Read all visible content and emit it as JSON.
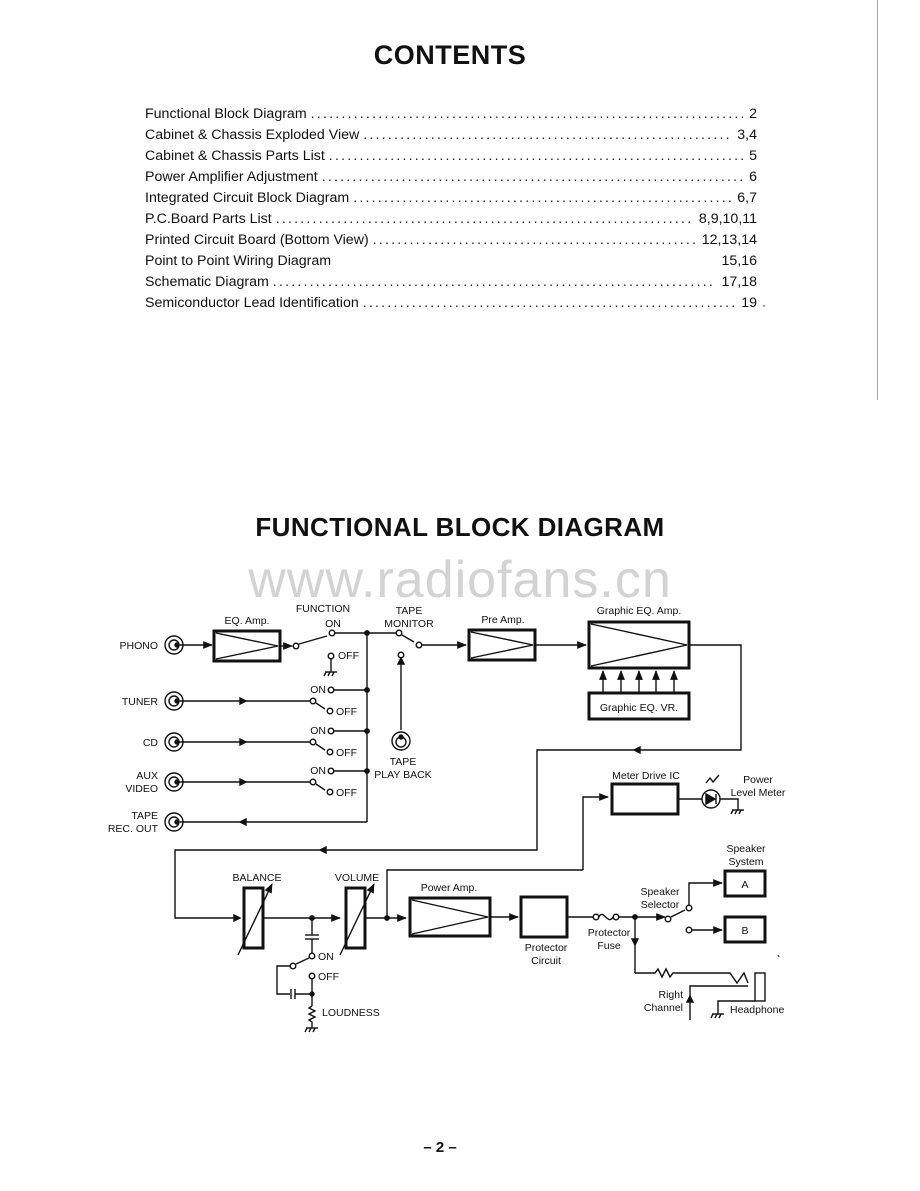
{
  "contents": {
    "title": "CONTENTS",
    "entries": [
      {
        "label": "Functional Block Diagram",
        "page": "2"
      },
      {
        "label": "Cabinet & Chassis Exploded View",
        "page": "3,4"
      },
      {
        "label": "Cabinet & Chassis Parts List",
        "page": "5"
      },
      {
        "label": "Power Amplifier Adjustment",
        "page": "6"
      },
      {
        "label": "Integrated Circuit Block Diagram",
        "page": "6,7"
      },
      {
        "label": "P.C.Board Parts List",
        "page": "8,9,10,11"
      },
      {
        "label": "Printed Circuit Board (Bottom View)",
        "page": "12,13,14"
      },
      {
        "label": "Point to Point Wiring Diagram",
        "page": "15,16"
      },
      {
        "label": "Schematic Diagram",
        "page": "17,18"
      },
      {
        "label": "Semiconductor Lead Identification",
        "page": "19"
      }
    ],
    "leader": "...................................................................................................."
  },
  "diagram": {
    "title": "FUNCTIONAL BLOCK DIAGRAM",
    "watermark": "www.radiofans.cn",
    "inputs": {
      "phono": "PHONO",
      "tuner": "TUNER",
      "cd": "CD",
      "aux_line1": "AUX",
      "aux_line2": "VIDEO",
      "tape_rec_line1": "TAPE",
      "tape_rec_line2": "REC. OUT"
    },
    "blocks": {
      "eq_amp": "EQ. Amp.",
      "pre_amp": "Pre Amp.",
      "graphic_eq_amp": "Graphic EQ. Amp.",
      "graphic_eq_vr": "Graphic EQ. VR.",
      "meter_drive_ic": "Meter Drive IC",
      "power_amp": "Power Amp.",
      "protector_circuit_line1": "Protector",
      "protector_circuit_line2": "Circuit",
      "speaker_a": "A",
      "speaker_b": "B"
    },
    "switches": {
      "function_line1": "FUNCTION",
      "function_line2": "ON",
      "on": "ON",
      "off": "OFF",
      "tape_monitor_line1": "TAPE",
      "tape_monitor_line2": "MONITOR",
      "tape_playback_line1": "TAPE",
      "tape_playback_line2": "PLAY BACK",
      "speaker_selector_line1": "Speaker",
      "speaker_selector_line2": "Selector"
    },
    "controls": {
      "balance": "BALANCE",
      "volume": "VOLUME",
      "loudness": "LOUDNESS"
    },
    "outputs": {
      "power_level_meter_line1": "Power",
      "power_level_meter_line2": "Level Meter",
      "speaker_system_line1": "Speaker",
      "speaker_system_line2": "System",
      "protector_fuse_line1": "Protector",
      "protector_fuse_line2": "Fuse",
      "right_channel_line1": "Right",
      "right_channel_line2": "Channel",
      "headphone": "Headphone"
    }
  },
  "footer": {
    "page_number": "– 2 –"
  }
}
